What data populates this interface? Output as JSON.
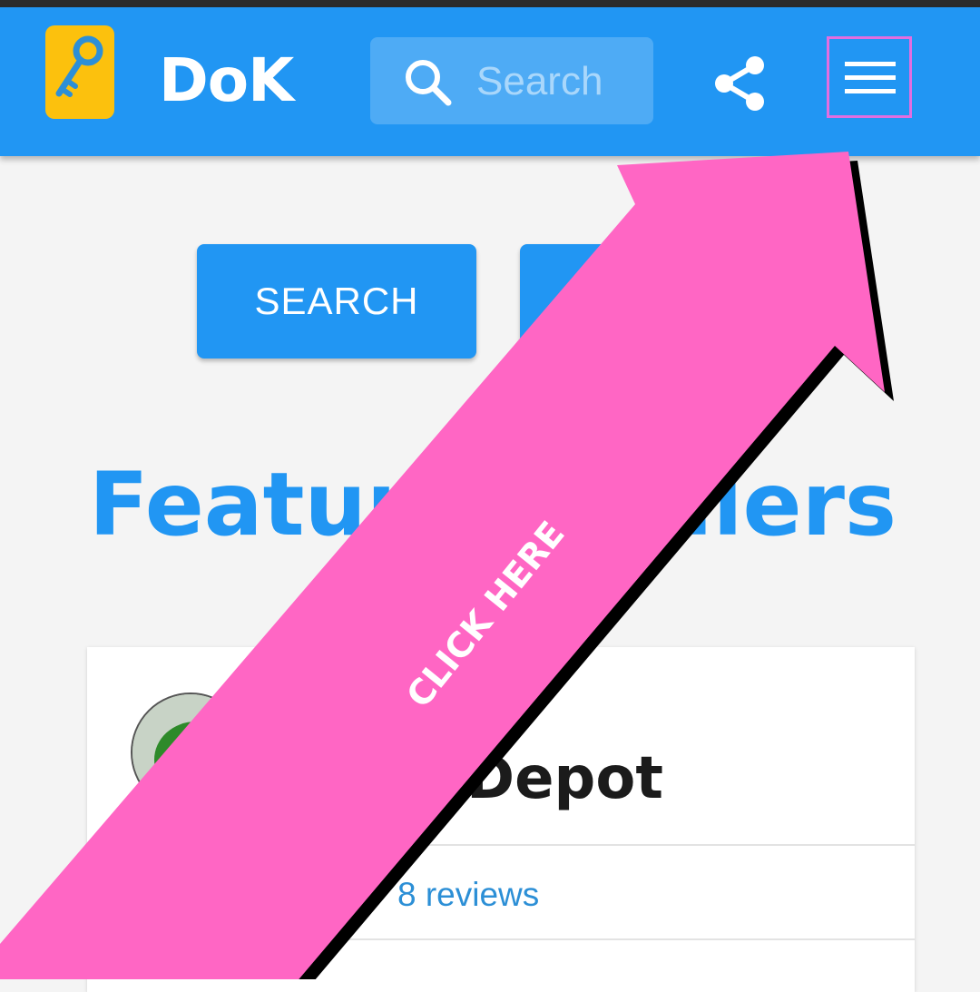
{
  "header": {
    "brand": "DoK",
    "search_placeholder": "Search"
  },
  "buttons": {
    "search_label": "SEARCH",
    "second_label": ""
  },
  "section": {
    "title": "Featured Sellers"
  },
  "card": {
    "name": "Depot",
    "reviews": "8 reviews"
  },
  "overlay": {
    "label": "CLICK HERE"
  },
  "colors": {
    "primary": "#2196f3",
    "logo": "#fcc10d",
    "arrow": "#ff66c4",
    "menu_highlight": "#e26ee0"
  }
}
